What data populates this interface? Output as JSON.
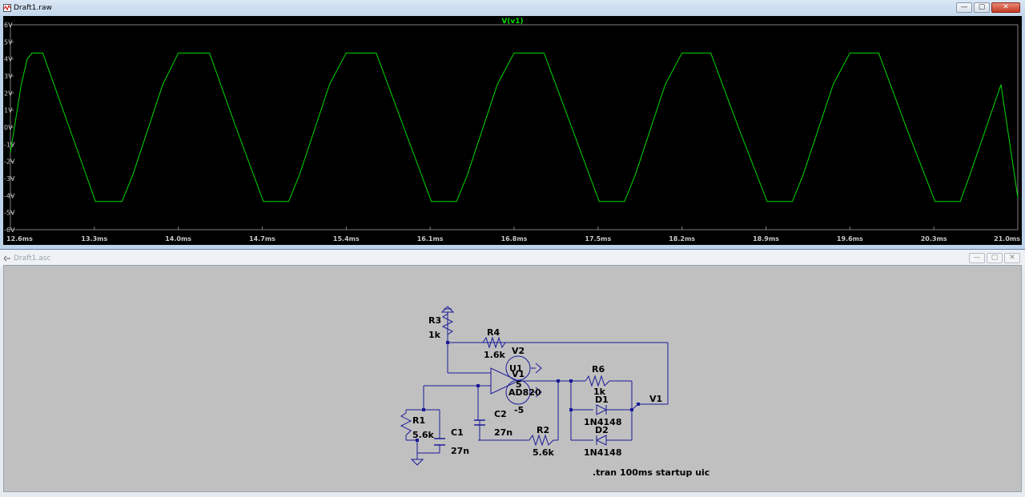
{
  "waveform_window": {
    "title": "Draft1.raw",
    "trace_label": "V(v1)",
    "trace_color": "#00dd00"
  },
  "schematic_window": {
    "title": "Draft1.asc"
  },
  "window_buttons": {
    "minimize": "—",
    "maximize": "▢",
    "close": "✕"
  },
  "chart_data": {
    "type": "line",
    "title": "V(v1)",
    "xlabel": "",
    "ylabel": "",
    "xlim": [
      12.6,
      21.0
    ],
    "ylim": [
      -6,
      6
    ],
    "x_unit": "ms",
    "y_ticks": [
      "6V",
      "5V",
      "4V",
      "3V",
      "2V",
      "1V",
      "0V",
      "-1V",
      "-2V",
      "-3V",
      "-4V",
      "-5V",
      "-6V"
    ],
    "x_ticks": [
      "12.6ms",
      "13.3ms",
      "14.0ms",
      "14.7ms",
      "15.4ms",
      "16.1ms",
      "16.8ms",
      "17.5ms",
      "18.2ms",
      "18.9ms",
      "19.6ms",
      "20.3ms",
      "21.0ms"
    ],
    "grid": false,
    "series": [
      {
        "name": "V(v1)",
        "color": "#00dd00",
        "x": [
          12.6,
          12.69,
          12.74,
          12.78,
          12.87,
          13.09,
          13.31,
          13.34,
          13.38,
          13.44,
          13.5,
          13.53,
          13.62,
          13.87,
          14.0,
          14.09,
          14.17,
          14.26,
          14.48,
          14.71,
          14.75,
          14.78,
          14.84,
          14.9,
          14.92,
          15.01,
          15.26,
          15.4,
          15.48,
          15.57,
          15.65,
          15.88,
          16.11,
          16.14,
          16.18,
          16.24,
          16.3,
          16.32,
          16.41,
          16.66,
          16.8,
          16.88,
          16.96,
          17.05,
          17.28,
          17.51,
          17.54,
          17.58,
          17.64,
          17.7,
          17.72,
          17.81,
          18.06,
          18.2,
          18.28,
          18.36,
          18.44,
          18.67,
          18.91,
          18.94,
          18.98,
          19.04,
          19.1,
          19.12,
          19.21,
          19.46,
          19.6,
          19.68,
          19.76,
          19.84,
          20.07,
          20.31,
          20.34,
          20.38,
          20.44,
          20.5,
          20.52,
          20.6,
          20.86,
          21.0
        ],
        "y": [
          -1.5,
          2.5,
          4.0,
          4.35,
          4.35,
          0,
          -4.35,
          -4.35,
          -4.35,
          -4.35,
          -4.35,
          -4.35,
          -2.8,
          2.5,
          4.35,
          4.35,
          4.35,
          4.35,
          0,
          -4.35,
          -4.35,
          -4.35,
          -4.35,
          -4.35,
          -4.35,
          -2.8,
          2.5,
          4.35,
          4.35,
          4.35,
          4.35,
          0,
          -4.35,
          -4.35,
          -4.35,
          -4.35,
          -4.35,
          -4.35,
          -2.8,
          2.5,
          4.35,
          4.35,
          4.35,
          4.35,
          0,
          -4.35,
          -4.35,
          -4.35,
          -4.35,
          -4.35,
          -4.35,
          -2.8,
          2.5,
          4.35,
          4.35,
          4.35,
          4.35,
          0,
          -4.35,
          -4.35,
          -4.35,
          -4.35,
          -4.35,
          -4.35,
          -2.8,
          2.5,
          4.35,
          4.35,
          4.35,
          4.35,
          0,
          -4.35,
          -4.35,
          -4.35,
          -4.35,
          -4.35,
          -4.35,
          -2.8,
          2.5,
          -4.1
        ]
      }
    ]
  },
  "components": {
    "R3": {
      "name": "R3",
      "value": "1k"
    },
    "R4": {
      "name": "R4",
      "value": "1.6k"
    },
    "V2": {
      "name": "V2"
    },
    "U1": {
      "name": "U1",
      "model": "AD820"
    },
    "V1": {
      "name": "V1",
      "value": "5"
    },
    "neg_supply": "-5",
    "R6": {
      "name": "R6",
      "value": "1k"
    },
    "D1": {
      "name": "D1",
      "model": "1N4148"
    },
    "D2": {
      "name": "D2",
      "model": "1N4148"
    },
    "R1": {
      "name": "R1",
      "value": "5.6k"
    },
    "C1": {
      "name": "C1",
      "value": "27n"
    },
    "C2": {
      "name": "C2",
      "value": "27n"
    },
    "R2": {
      "name": "R2",
      "value": "5.6k"
    },
    "net_label": "V1",
    "directive": ".tran 100ms startup uic"
  }
}
